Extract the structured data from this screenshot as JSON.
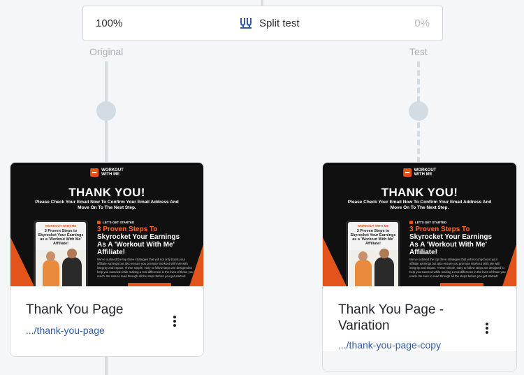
{
  "split_test": {
    "original_percent": "100%",
    "label": "Split test",
    "test_percent": "0%",
    "icon": "split-test-icon"
  },
  "branches": {
    "original_label": "Original",
    "test_label": "Test"
  },
  "cards": [
    {
      "title": "Thank You Page",
      "link": ".../thank-you-page",
      "menu_icon": "more-vertical-icon"
    },
    {
      "title": "Thank You Page - Variation",
      "link": ".../thank-you-page-copy",
      "menu_icon": "more-vertical-icon"
    }
  ],
  "thumbnail": {
    "logo_text_line1": "WORKOUT",
    "logo_text_line2": "WITH ME",
    "headline": "THANK YOU!",
    "subheadline": "Please Check Your Email Now To Confirm Your Email Address And Move On To The Next Step.",
    "tablet_brand": "WORKOUT WITH ME",
    "tablet_heading": "3 Proven Steps to Skyrocket Your Earnings as a 'Workout With Me' Affiliate!",
    "eyebrow": "LET'S GET STARTED",
    "heading_part1": "3 Proven Steps To",
    "heading_part2": "Skyrocket Your Earnings",
    "heading_part3": "As A 'Workout With Me'",
    "heading_part4": "Affiliate!",
    "body": "We've outlined the top three strategies that will not only boost your affiliate earnings but also ensure you promote Workout With Me with integrity and impact. These simple, easy to follow steps are designed to help you succeed while making a real difference in the lives of those you reach. Be sure to read through all the steps before you get started!"
  },
  "colors": {
    "accent": "#e2541c",
    "link": "#2f5aa8",
    "connector": "#d3dce3",
    "split_icon": "#2f5aa8"
  }
}
